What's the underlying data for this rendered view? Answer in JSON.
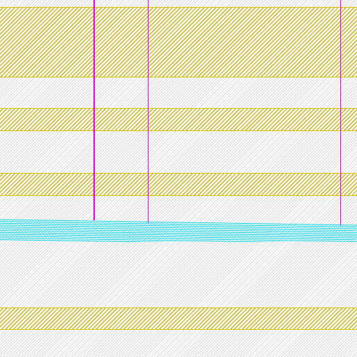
{
  "colors": {
    "background": "#ffffff",
    "hatch": "#d6d6d6",
    "band_hatch": "#cfc35a",
    "band_border": "#d6c400",
    "vertical_lines": "#e000e0",
    "cyan_lines": "#00d8e8"
  },
  "bands": [
    {
      "name": "band-1"
    },
    {
      "name": "band-2"
    },
    {
      "name": "band-3"
    },
    {
      "name": "band-4"
    }
  ],
  "vertical_lines": [
    {
      "name": "vline-1"
    },
    {
      "name": "vline-2"
    },
    {
      "name": "vline-3"
    }
  ]
}
